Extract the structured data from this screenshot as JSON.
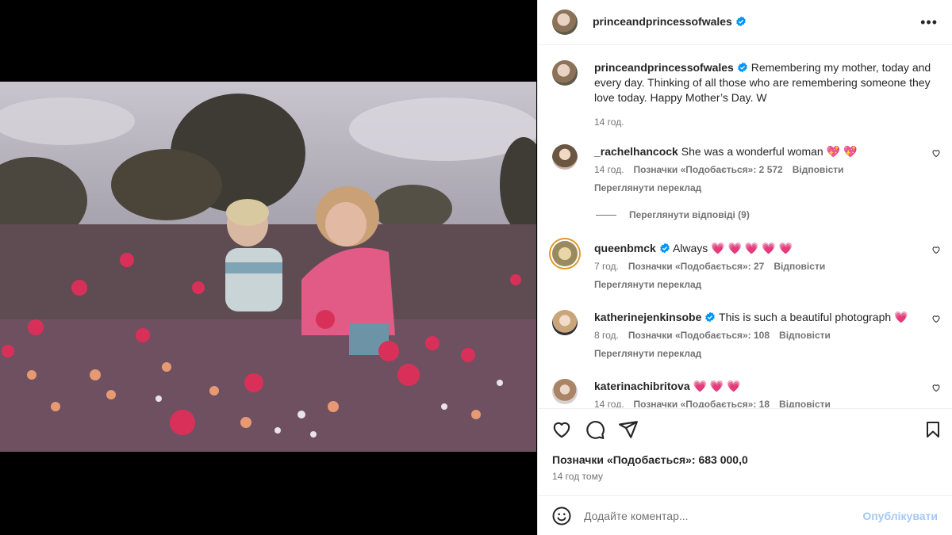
{
  "post": {
    "author": "princeandprincessofwales",
    "caption": "Remembering my mother, today and every day. Thinking of all those who are remembering someone they love today. Happy Mother’s Day. W",
    "caption_time": "14 год."
  },
  "comments": [
    {
      "user": "_rachelhancock",
      "verified": false,
      "text": "She was a wonderful woman",
      "emojis": "💖 💖",
      "time": "14 год.",
      "likes": "Позначки «Подобається»: 2 572",
      "reply": "Відповісти",
      "translate": "Переглянути переклад",
      "view_replies": "Переглянути відповіді (9)"
    },
    {
      "user": "queenbmck",
      "verified": true,
      "text": "Always",
      "emojis": "💗 💗 💗 💗 💗",
      "time": "7 год.",
      "likes": "Позначки «Подобається»: 27",
      "reply": "Відповісти",
      "translate": "Переглянути переклад"
    },
    {
      "user": "katherinejenkinsobe",
      "verified": true,
      "text": "This is such a beautiful photograph",
      "emojis": "💗",
      "time": "8 год.",
      "likes": "Позначки «Подобається»: 108",
      "reply": "Відповісти",
      "translate": "Переглянути переклад"
    },
    {
      "user": "katerinachibritova",
      "verified": false,
      "text": "",
      "emojis": "💗 💗 💗",
      "time": "14 год.",
      "likes": "Позначки «Подобається»: 18",
      "reply": "Відповісти"
    }
  ],
  "footer": {
    "likes": "Позначки «Подобається»: 683 000,0",
    "date": "14 год тому",
    "comment_placeholder": "Додайте коментар...",
    "post_button": "Опублікувати"
  },
  "colors": {
    "verified": "#0095f6",
    "link_disabled": "#a5c8f2",
    "secondary_text": "#737373"
  }
}
